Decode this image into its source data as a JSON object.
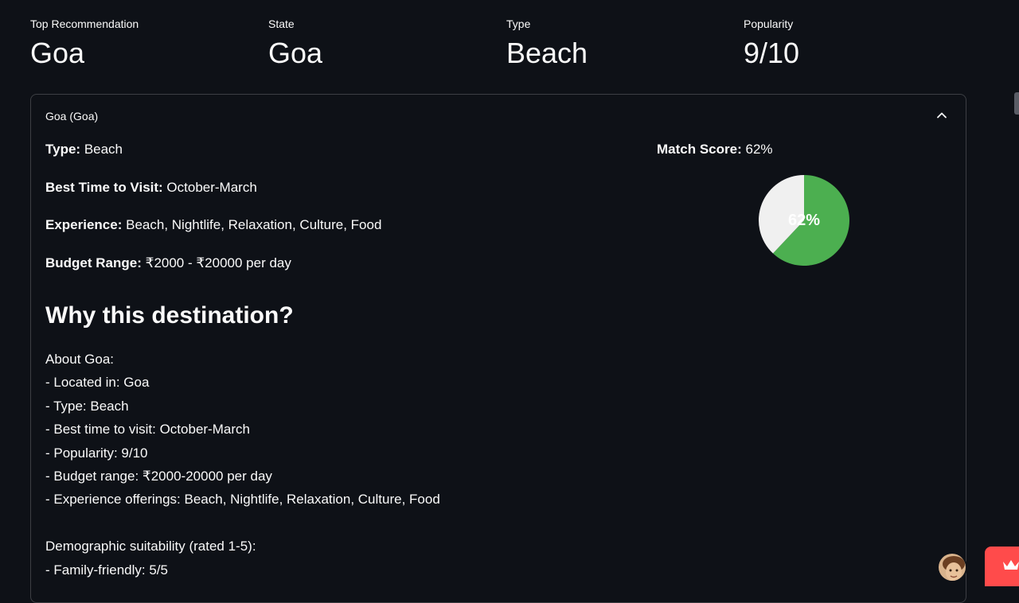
{
  "metrics": [
    {
      "label": "Top Recommendation",
      "value": "Goa"
    },
    {
      "label": "State",
      "value": "Goa"
    },
    {
      "label": "Type",
      "value": "Beach"
    },
    {
      "label": "Popularity",
      "value": "9/10"
    }
  ],
  "expander": {
    "title": "Goa (Goa)",
    "chevron_icon": "chevron-up-icon",
    "details": [
      {
        "label": "Type:",
        "value": "Beach"
      },
      {
        "label": "Best Time to Visit:",
        "value": "October-March"
      },
      {
        "label": "Experience:",
        "value": "Beach, Nightlife, Relaxation, Culture, Food"
      },
      {
        "label": "Budget Range:",
        "value": "₹2000 - ₹20000 per day"
      }
    ],
    "why_heading": "Why this destination?",
    "about_lines": [
      "About Goa:",
      "- Located in: Goa",
      "- Type: Beach",
      "- Best time to visit: October-March",
      "- Popularity: 9/10",
      "- Budget range: ₹2000-20000 per day",
      "- Experience offerings: Beach, Nightlife, Relaxation, Culture, Food"
    ],
    "demographic_lines": [
      "Demographic suitability (rated 1-5):",
      "- Family-friendly: 5/5"
    ],
    "match_score": {
      "label": "Match Score:",
      "value": "62%"
    }
  },
  "chart_data": {
    "type": "pie",
    "title": "",
    "center_label": "62%",
    "slices": [
      {
        "value": 62,
        "color": "#4caf50"
      },
      {
        "value": 38,
        "color": "#f0f0f0"
      }
    ]
  },
  "colors": {
    "background": "#0e1117",
    "text": "#fafafa",
    "border": "rgba(250,250,250,0.2)",
    "pie_match": "#4caf50",
    "pie_rest": "#f0f0f0",
    "badge": "#ff4b4b"
  },
  "icons": {
    "avatar": "avatar",
    "badge": "crown-icon"
  }
}
